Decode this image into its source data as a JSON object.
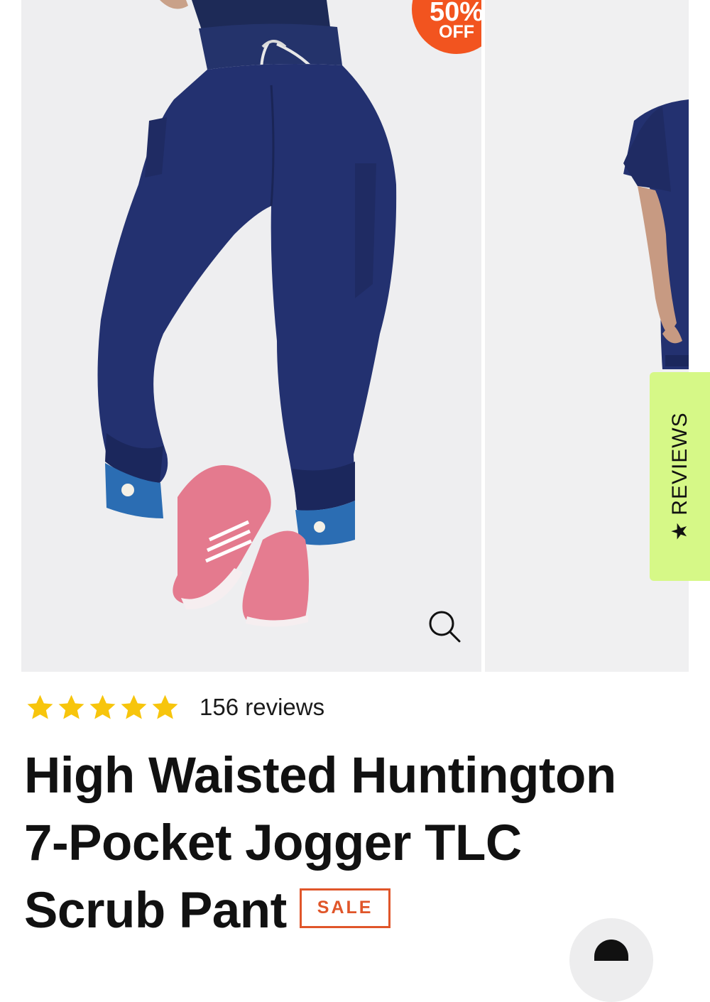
{
  "gallery": {
    "slides": [
      {
        "alt": "model wearing navy jogger scrub pants with pink sneakers"
      },
      {
        "alt": "model wearing navy scrub top, side view"
      }
    ],
    "sale_burst": {
      "percent": "50%",
      "off": "OFF",
      "color": "#f2541f"
    },
    "zoom_icon": "magnifier-icon"
  },
  "reviews_tab": {
    "label": "REVIEWS",
    "star": "★",
    "color": "#d6f887"
  },
  "rating": {
    "stars": 5,
    "star_color": "#f7c50c",
    "count_text": "156 reviews"
  },
  "product": {
    "title_line1": "High Waisted Huntington",
    "title_line2": "7-Pocket Jogger TLC",
    "title_line3": "Scrub Pant",
    "badge": "SALE",
    "badge_color": "#e0562a"
  },
  "chat": {
    "icon": "chat-icon"
  }
}
